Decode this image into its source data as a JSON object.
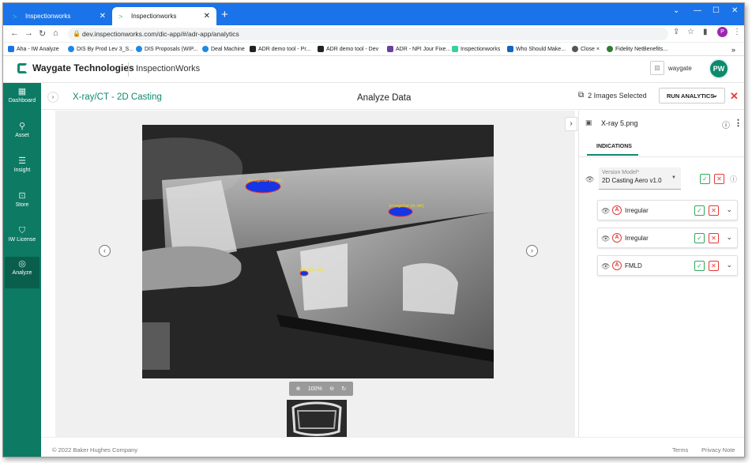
{
  "browser": {
    "tabs": [
      {
        "title": "Inspectionworks"
      },
      {
        "title": "Inspectionworks"
      }
    ],
    "new_tab": "+",
    "url": "dev.inspectionworks.com/dic-app/#/adr-app/analytics",
    "profile_initial": "P",
    "bookmarks": [
      "Aha - IW Analyze",
      "DIS By Prod Lev 3_S...",
      "DIS Proposals (WIP...",
      "Deal Machine",
      "ADR demo tool - Pr...",
      "ADR demo tool - Dev",
      "ADR - NPI Jour Fixe...",
      "Inspectionworks",
      "Who Should Make...",
      "Close ×",
      "Fidelity NetBenefits..."
    ]
  },
  "app": {
    "brand": "Waygate Technologies",
    "product": "InspectionWorks",
    "org_name": "waygate",
    "user_initials": "PW",
    "accent": "#0d8a6e"
  },
  "sidebar": {
    "items": [
      {
        "label": "Dashboard",
        "icon": "dashboard-icon"
      },
      {
        "label": "Asset",
        "icon": "asset-icon"
      },
      {
        "label": "Insight",
        "icon": "insight-icon"
      },
      {
        "label": "Store",
        "icon": "store-icon"
      },
      {
        "label": "IW License",
        "icon": "license-icon"
      },
      {
        "label": "Analyze",
        "icon": "analyze-icon",
        "active": true
      }
    ]
  },
  "toolbar": {
    "breadcrumb": "X-ray/CT - 2D Casting",
    "title": "Analyze Data",
    "images_selected": "2 Images Selected",
    "run_analytics": "RUN ANALYTICS"
  },
  "viewer": {
    "zoom": "100%",
    "annotations": [
      "Irregular(0.98)",
      "Irregular(0.99)",
      "FMLD(0.93)"
    ]
  },
  "panel": {
    "filename": "X-ray 5.png",
    "tab": "INDICATIONS",
    "version_model_label": "Version Model*",
    "version_model_value": "2D Casting Aero v1.0",
    "indications": [
      {
        "label": "Irregular"
      },
      {
        "label": "Irregular"
      },
      {
        "label": "FMLD"
      }
    ]
  },
  "footer": {
    "copyright": "© 2022 Baker Hughes Company",
    "terms": "Terms",
    "privacy": "Privacy Note"
  }
}
